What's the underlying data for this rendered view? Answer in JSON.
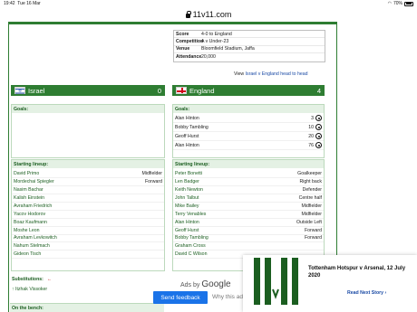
{
  "status": {
    "time": "19:42",
    "date": "Tue 16 Mar",
    "battery": "70%"
  },
  "url": "11v11.com",
  "match_info": [
    {
      "key": "Score",
      "value": "4-0 to England"
    },
    {
      "key": "Competition",
      "value": "A v Under-23"
    },
    {
      "key": "Venue",
      "value": "Bloomfield Stadium, Jaffa"
    },
    {
      "key": "Attendance",
      "value": "20,000"
    }
  ],
  "h2h": {
    "prefix": "View",
    "link": "Israel v England head to head"
  },
  "home": {
    "name": "Israel",
    "score": "0"
  },
  "away": {
    "name": "England",
    "score": "4"
  },
  "labels": {
    "goals": "Goals:",
    "lineup": "Starting lineup:",
    "substitutions": "Substitutions:",
    "bench": "On the bench:"
  },
  "away_goals": [
    {
      "player": "Alan Hinton",
      "minute": "3"
    },
    {
      "player": "Bobby Tambling",
      "minute": "10"
    },
    {
      "player": "Geoff Hurst",
      "minute": "20"
    },
    {
      "player": "Alan Hinton",
      "minute": "76"
    }
  ],
  "home_lineup": [
    {
      "name": "David Primo",
      "pos": "Midfielder"
    },
    {
      "name": "Mordechai Spiegler",
      "pos": "Forward"
    },
    {
      "name": "Nasim Bachar",
      "pos": ""
    },
    {
      "name": "Kalish Einstein",
      "pos": ""
    },
    {
      "name": "Avraham Friedrich",
      "pos": ""
    },
    {
      "name": "Yacov Hodorov",
      "pos": ""
    },
    {
      "name": "Boaz Kaufmann",
      "pos": ""
    },
    {
      "name": "Moshe Leon",
      "pos": ""
    },
    {
      "name": "Avraham Levkowitch",
      "pos": ""
    },
    {
      "name": "Nahum Stelmach",
      "pos": ""
    },
    {
      "name": "Gideon Tisch",
      "pos": ""
    }
  ],
  "away_lineup": [
    {
      "name": "Peter Bonetti",
      "pos": "Goalkeeper"
    },
    {
      "name": "Len Badger",
      "pos": "Right back"
    },
    {
      "name": "Keith Newton",
      "pos": "Defender"
    },
    {
      "name": "John Talbut",
      "pos": "Centre half"
    },
    {
      "name": "Mike Bailey",
      "pos": "Midfielder"
    },
    {
      "name": "Terry Venables",
      "pos": "Midfielder"
    },
    {
      "name": "Alan Hinton",
      "pos": "Outside Left"
    },
    {
      "name": "Geoff Hurst",
      "pos": "Forward"
    },
    {
      "name": "Bobby Tambling",
      "pos": "Forward"
    },
    {
      "name": "Graham Cross",
      "pos": ""
    },
    {
      "name": "David C Wilson",
      "pos": ""
    }
  ],
  "home_subs": [
    {
      "name": "Itzhak Vissoker"
    }
  ],
  "ads": {
    "ads_by": "Ads by",
    "google": "Google",
    "send_feedback": "Send feedback",
    "why": "Why this ad"
  },
  "popup": {
    "title": "Tottenham Hotspur v Arsenal, 12 July 2020",
    "next": "Read Next Story ›"
  }
}
